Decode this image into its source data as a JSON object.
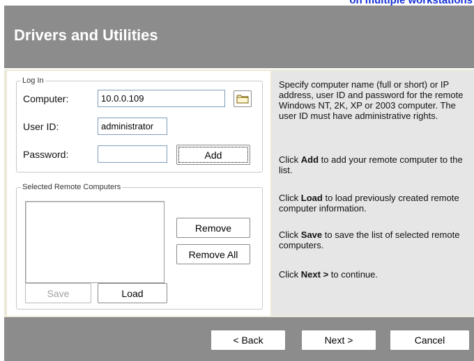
{
  "top_caption": "on multiple workstations",
  "header": {
    "title": "Drivers and Utilities"
  },
  "login": {
    "legend": "Log In",
    "computer_label": "Computer:",
    "computer_value": "10.0.0.109",
    "userid_label": "User ID:",
    "userid_value": "administrator",
    "password_label": "Password:",
    "password_value": "",
    "add_label": "Add"
  },
  "selected": {
    "legend": "Selected Remote Computers",
    "items": [],
    "remove_label": "Remove",
    "remove_all_label": "Remove All",
    "save_label": "Save",
    "load_label": "Load"
  },
  "help": {
    "p1": "Specify computer name (full or short) or IP address, user ID and password for the remote Windows NT, 2K, XP or 2003 computer. The user ID must have administrative rights.",
    "p2_pre": "Click ",
    "p2_bold": "Add",
    "p2_post": " to add your remote computer to the list.",
    "p3_pre": "Click ",
    "p3_bold": "Load",
    "p3_post": " to load previously created remote computer information.",
    "p4_pre": "Click ",
    "p4_bold": "Save",
    "p4_post": " to save the list of selected remote computers.",
    "p5_pre": "Click ",
    "p5_bold": "Next >",
    "p5_post": " to continue."
  },
  "footer": {
    "back_label": "< Back",
    "next_label": "Next >",
    "cancel_label": "Cancel"
  },
  "colors": {
    "header_bg": "#8c8c8c",
    "help_bg": "#e6e6e6",
    "caption_text": "#1430d8"
  },
  "icons": {
    "browse": "folder-icon"
  }
}
